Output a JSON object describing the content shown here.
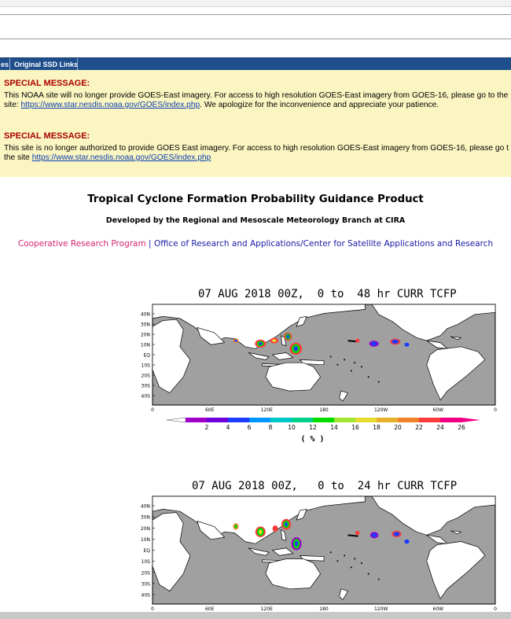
{
  "navbar": {
    "tabs": [
      "es",
      "Original SSD Links",
      ""
    ]
  },
  "messages": [
    {
      "title": "SPECIAL MESSAGE:",
      "line1": "This NOAA site will no longer provide GOES-East imagery. For access to high resolution GOES-East imagery from GOES-16, please go to the",
      "line2_prefix": "site: ",
      "link": "https://www.star.nesdis.noaa.gov/GOES/index.php",
      "line2_suffix": ". We apologize for the inconvenience and appreciate your patience."
    },
    {
      "title": "SPECIAL MESSAGE:",
      "line1": "This site is no longer authorized to provide GOES East imagery. For access to high resolution GOES-East imagery from GOES-16, please go t",
      "line2_prefix": "the site ",
      "link": "https://www.star.nesdis.noaa.gov/GOES/index.php",
      "line2_suffix": ""
    }
  ],
  "page": {
    "title": "Tropical Cyclone Formation Probability Guidance Product",
    "subtitle": "Developed by the Regional and Mesoscale Meteorology Branch at CIRA",
    "link1": "Cooperative Research Program",
    "separator": " | ",
    "link2": "Office of Research and Applications/Center for Satellite Applications and Research"
  },
  "maps": [
    {
      "title": "07 AUG 2018 00Z,  0 to  48 hr CURR TCFP"
    },
    {
      "title": "07 AUG 2018 00Z,   0 to  24 hr CURR TCFP"
    }
  ],
  "axes": {
    "lat_labels": [
      "40N",
      "30N",
      "20N",
      "10N",
      "EQ",
      "10S",
      "20S",
      "30S",
      "40S"
    ],
    "lon_labels": [
      "0",
      "60E",
      "120E",
      "180",
      "120W",
      "60W",
      "0"
    ]
  },
  "colorbar": {
    "labels": [
      "2",
      "4",
      "6",
      "8",
      "10",
      "12",
      "14",
      "16",
      "18",
      "20",
      "22",
      "24",
      "26"
    ],
    "unit": "( % )",
    "colors": [
      "#a000c8",
      "#6e00dc",
      "#1e3cff",
      "#0096ff",
      "#00c8c8",
      "#00d28c",
      "#00dc00",
      "#a0e632",
      "#e6dc32",
      "#e6af2d",
      "#f08228",
      "#fa3c3c",
      "#f00082"
    ]
  }
}
